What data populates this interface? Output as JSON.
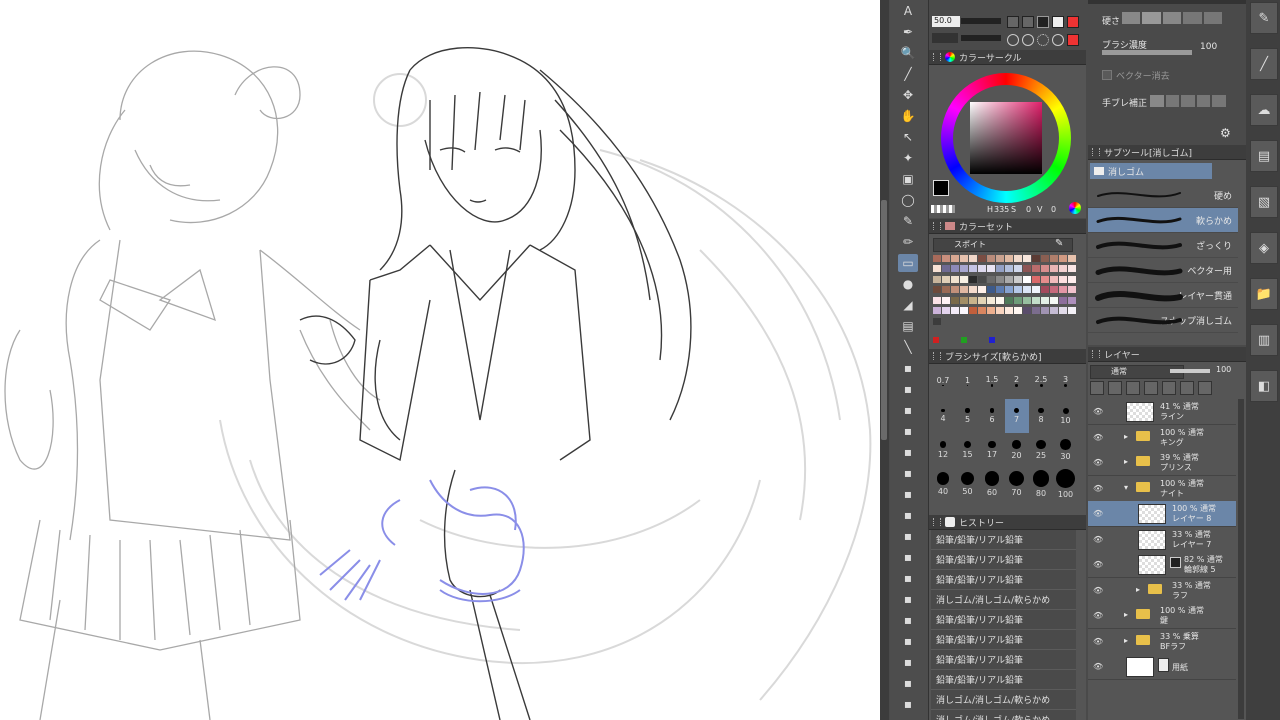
{
  "toolbar": {
    "icons": [
      "text-tool-icon",
      "pen-tool-icon",
      "zoom-tool-icon",
      "eyedropper-tool-icon",
      "move-tool-icon",
      "hand-tool-icon",
      "select-tool-icon",
      "magic-wand-icon",
      "fill-tool-icon",
      "lasso-icon",
      "brush-tool-icon",
      "pencil-tool-icon",
      "eraser-tool-icon",
      "blend-tool-icon",
      "figure-tool-icon",
      "gradient-tool-icon",
      "ruler-tool-icon"
    ]
  },
  "brush_controls": {
    "size_value": "50.0",
    "hardness_label": "硬さ",
    "density_label": "ブラシ濃度",
    "density_value": "100",
    "vector_erase_label": "ベクター消去",
    "stabilize_label": "手ブレ補正"
  },
  "color_circle": {
    "title": "カラーサークル",
    "hue_value": "335",
    "hue_label": "H",
    "s_label": "S",
    "s_value": "0",
    "v_label": "V",
    "v_value": "0"
  },
  "color_set": {
    "title": "カラーセット",
    "set_name": "スポイト",
    "swatches": [
      "#a86a5a",
      "#c98f7d",
      "#d8a892",
      "#e6c1ad",
      "#f0d6c8",
      "#7a4d43",
      "#b98b7a",
      "#caa28f",
      "#e0b9a2",
      "#f2dacb",
      "#f7e6dc",
      "#5b3b34",
      "#8a5f52",
      "#b07e6b",
      "#d29a82",
      "#e8c2ad",
      "#f7e1d4",
      "#6f6a92",
      "#8c8ab8",
      "#a7a6cf",
      "#c4c3e4",
      "#ded9ee",
      "#e9e4f3",
      "#93a0c4",
      "#b2bfdc",
      "#d0d8ec",
      "#8d5454",
      "#b96c6c",
      "#d88e8e",
      "#eab5b5",
      "#f4d2d2",
      "#fae6e6",
      "#c7b49b",
      "#e0cfb8",
      "#efe2cf",
      "#f8f0e4",
      "#2b2b2b",
      "#4a4a4a",
      "#6b6b6b",
      "#8a8a8a",
      "#aaaaaa",
      "#cccccc",
      "#ffffff",
      "#d96a6a",
      "#e58c8c",
      "#f2bcbc",
      "#fde0e0",
      "#ffeeee",
      "#6d4a3b",
      "#9a6a55",
      "#c1907a",
      "#e0b8a3",
      "#f5dccd",
      "#fff1ea",
      "#3d5a8a",
      "#5b7bb0",
      "#86a2d0",
      "#b5c8e8",
      "#dbe5f5",
      "#f0f4fb",
      "#a34a5c",
      "#c66a7c",
      "#e396a5",
      "#f2c3cd",
      "#fbe2e7",
      "#fff3f5",
      "#7a6a4a",
      "#a38e66",
      "#c8b48c",
      "#e3d4b6",
      "#f4ebda",
      "#fcf8f0",
      "#4f7a5a",
      "#6e9c79",
      "#97bfa0",
      "#c3dfc9",
      "#e3f0e6",
      "#f5faf6",
      "#8d6e9c",
      "#ad8fbc",
      "#cbb2d9",
      "#e4d4ee",
      "#f4ecf8",
      "#fbf7fd",
      "#c15f3c",
      "#da8660",
      "#eeb08f",
      "#f8d4bf",
      "#fdebe0",
      "#fff7f2",
      "#5a4d6b",
      "#7b6d8e",
      "#a093b2",
      "#c5bcd4",
      "#e2dcea",
      "#f4f1f7",
      "#3c3c3c"
    ],
    "primaries": [
      "#d02020",
      "#20a020",
      "#2020d0"
    ]
  },
  "brush_size": {
    "title": "ブラシサイズ[軟らかめ]",
    "sizes": [
      "0.7",
      "1",
      "1.5",
      "2",
      "2.5",
      "3",
      "4",
      "5",
      "6",
      "7",
      "8",
      "10",
      "12",
      "15",
      "17",
      "20",
      "25",
      "30",
      "40",
      "50",
      "60",
      "70",
      "80",
      "100"
    ]
  },
  "history": {
    "title": "ヒストリー",
    "items": [
      "鉛筆/鉛筆/リアル鉛筆",
      "鉛筆/鉛筆/リアル鉛筆",
      "鉛筆/鉛筆/リアル鉛筆",
      "消しゴム/消しゴム/軟らかめ",
      "鉛筆/鉛筆/リアル鉛筆",
      "鉛筆/鉛筆/リアル鉛筆",
      "鉛筆/鉛筆/リアル鉛筆",
      "鉛筆/鉛筆/リアル鉛筆",
      "消しゴム/消しゴム/軟らかめ",
      "消しゴム/消しゴム/軟らかめ"
    ]
  },
  "sub_tool": {
    "title": "サブツール[消しゴム]",
    "group": "消しゴム",
    "items": [
      "硬め",
      "軟らかめ",
      "ざっくり",
      "ベクター用",
      "レイヤー貫通",
      "スナップ消しゴム"
    ]
  },
  "layers": {
    "title": "レイヤー",
    "blend_mode": "通常",
    "opacity": "100",
    "rows": [
      {
        "line1": "41 % 通常",
        "line2": "ライン",
        "kind": "layer"
      },
      {
        "line1": "100 % 通常",
        "line2": "キング",
        "kind": "folder"
      },
      {
        "line1": "39 % 通常",
        "line2": "プリンス",
        "kind": "folder"
      },
      {
        "line1": "100 % 通常",
        "line2": "ナイト",
        "kind": "folder-open"
      },
      {
        "line1": "100 % 通常",
        "line2": "レイヤー 8",
        "kind": "layer"
      },
      {
        "line1": "33 % 通常",
        "line2": "レイヤー 7",
        "kind": "layer"
      },
      {
        "line1": "82 % 通常",
        "line2": "輪郭線 5",
        "kind": "layer"
      },
      {
        "line1": "33 % 通常",
        "line2": "ラフ",
        "kind": "folder"
      },
      {
        "line1": "100 % 通常",
        "line2": "鍵",
        "kind": "folder"
      },
      {
        "line1": "33 % 乗算",
        "line2": "BFラフ",
        "kind": "folder"
      },
      {
        "line1": "",
        "line2": "用紙",
        "kind": "paper"
      }
    ]
  },
  "right_toolbar": {
    "icons": [
      "brush-preset-icon",
      "pen-curve-icon",
      "blur-icon",
      "layer-property-icon",
      "navigator-icon",
      "material-icon",
      "folder-icon",
      "layer-icon",
      "shape-icon"
    ]
  }
}
